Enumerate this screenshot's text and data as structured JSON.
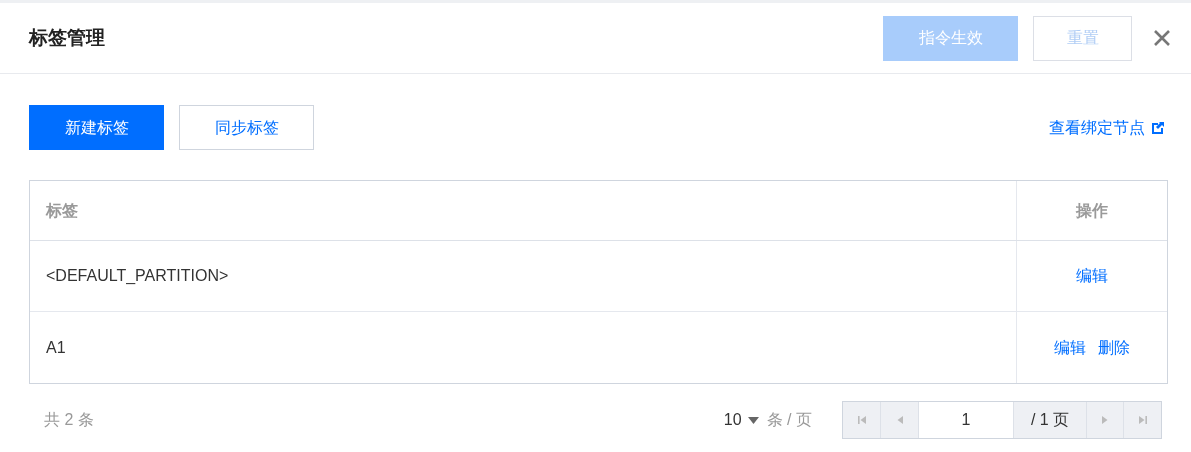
{
  "dialog": {
    "title": "标签管理",
    "buttons": [
      {
        "label": "指令生效",
        "kind": "primary",
        "disabled": true
      },
      {
        "label": "重置",
        "kind": "default",
        "disabled": true
      }
    ]
  },
  "toolbar": {
    "buttons": [
      {
        "label": "新建标签",
        "kind": "primary"
      },
      {
        "label": "同步标签",
        "kind": "default"
      }
    ],
    "link": "查看绑定节点"
  },
  "table": {
    "columns": [
      "标签",
      "操作"
    ],
    "rows": [
      {
        "label": "<DEFAULT_PARTITION>",
        "actions": [
          "编辑"
        ]
      },
      {
        "label": "A1",
        "actions": [
          "编辑",
          "删除"
        ]
      }
    ]
  },
  "pagination": {
    "total": "共 2 条",
    "page_size": "10",
    "page_size_unit": "条 / 页",
    "page": "1",
    "pages": "/ 1 页"
  }
}
